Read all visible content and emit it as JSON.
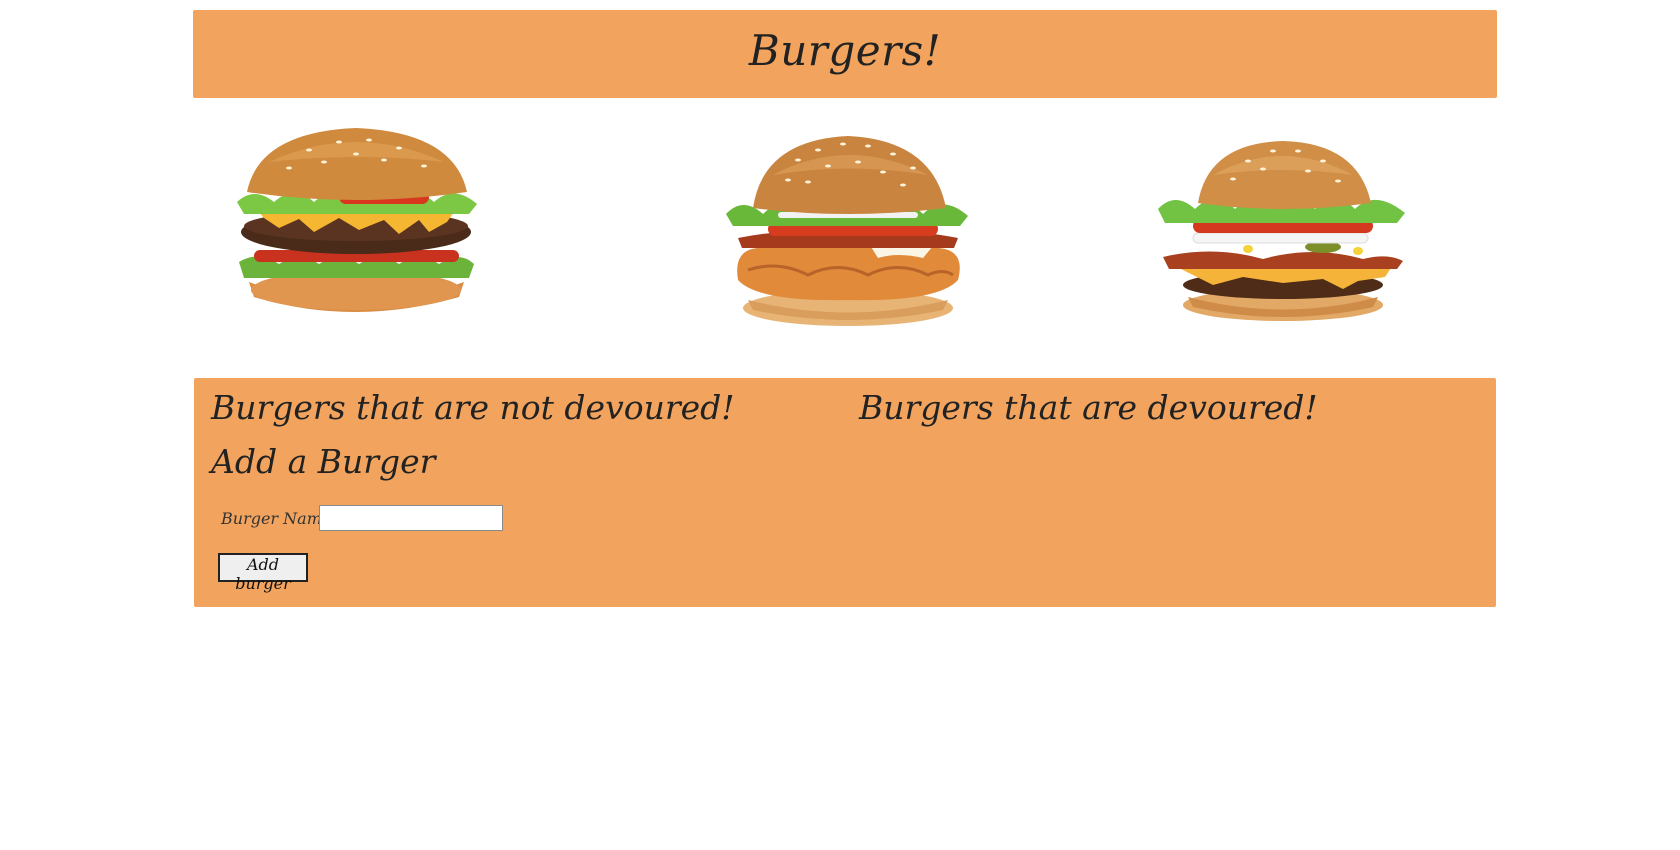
{
  "header": {
    "title": "Burgers!"
  },
  "images": [
    {
      "name": "burger-image-1",
      "alt": "burger"
    },
    {
      "name": "burger-image-2",
      "alt": "burger"
    },
    {
      "name": "burger-image-3",
      "alt": "burger"
    }
  ],
  "panel": {
    "not_devoured_heading": "Burgers that are not devoured!",
    "devoured_heading": "Burgers that are devoured!",
    "add_heading": "Add a Burger",
    "form": {
      "label": "Burger Name:",
      "input_value": "",
      "button_label": "Add burger"
    }
  },
  "colors": {
    "accent": "#f2a45e",
    "background": "#ffffff"
  }
}
